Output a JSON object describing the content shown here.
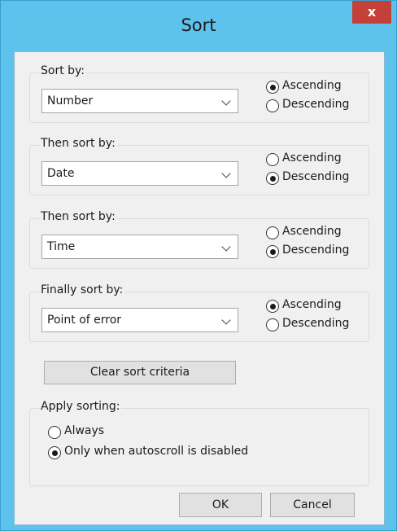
{
  "window": {
    "title": "Sort",
    "close_label": "x"
  },
  "sort_groups": [
    {
      "label": "Sort by:",
      "selected": "Number",
      "ascending_label": "Ascending",
      "descending_label": "Descending",
      "order": "Ascending"
    },
    {
      "label": "Then sort by:",
      "selected": "Date",
      "ascending_label": "Ascending",
      "descending_label": "Descending",
      "order": "Descending"
    },
    {
      "label": "Then sort by:",
      "selected": "Time",
      "ascending_label": "Ascending",
      "descending_label": "Descending",
      "order": "Descending"
    },
    {
      "label": "Finally sort by:",
      "selected": "Point of error",
      "ascending_label": "Ascending",
      "descending_label": "Descending",
      "order": "Ascending"
    }
  ],
  "clear_button": "Clear sort criteria",
  "apply_sorting": {
    "label": "Apply sorting:",
    "options": [
      "Always",
      "Only when autoscroll is disabled"
    ],
    "selected": "Only when autoscroll is disabled"
  },
  "buttons": {
    "ok": "OK",
    "cancel": "Cancel"
  },
  "colors": {
    "title_bar": "#5ec3ec",
    "close_button": "#c6403a",
    "client_background": "#f0f0f0"
  }
}
